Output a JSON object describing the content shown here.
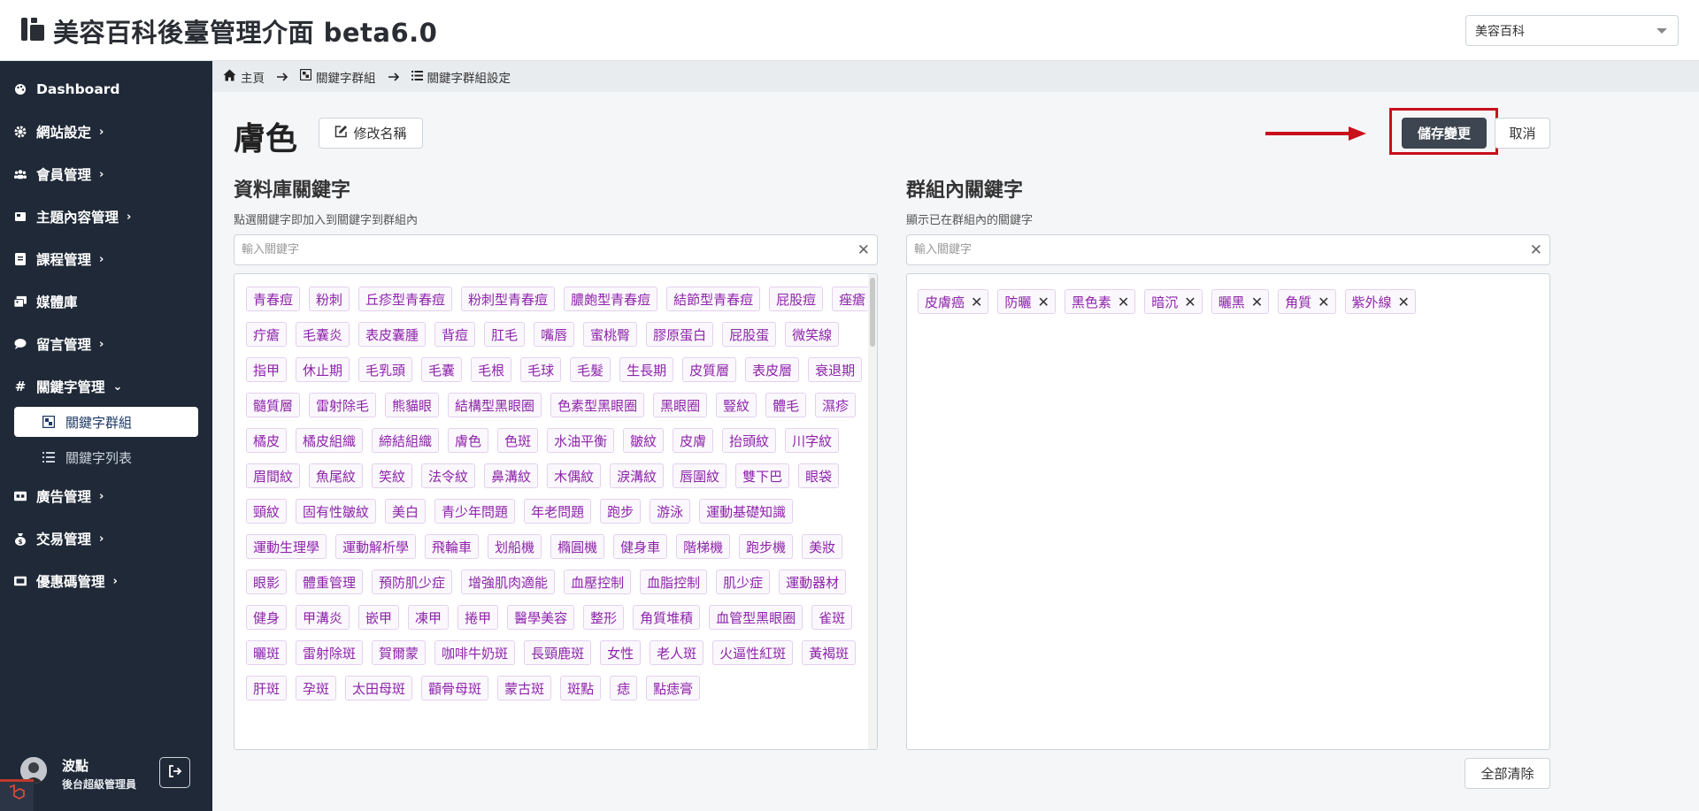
{
  "app": {
    "title": "美容百科後臺管理介面 beta6.0"
  },
  "site_select": {
    "value": "美容百科"
  },
  "sidebar": {
    "items": [
      {
        "label": "Dashboard",
        "icon": "palette-icon"
      },
      {
        "label": "網站設定",
        "icon": "gear-icon"
      },
      {
        "label": "會員管理",
        "icon": "users-icon"
      },
      {
        "label": "主題內容管理",
        "icon": "book-icon"
      },
      {
        "label": "課程管理",
        "icon": "notebook-icon"
      },
      {
        "label": "媒體庫",
        "icon": "images-icon"
      },
      {
        "label": "留言管理",
        "icon": "comment-icon"
      },
      {
        "label": "關鍵字管理",
        "icon": "hashtag-icon"
      },
      {
        "label": "廣告管理",
        "icon": "ad-icon"
      },
      {
        "label": "交易管理",
        "icon": "money-bag-icon"
      },
      {
        "label": "優惠碼管理",
        "icon": "ticket-icon"
      }
    ],
    "sub_items": [
      {
        "label": "關鍵字群組",
        "icon": "group-icon"
      },
      {
        "label": "關鍵字列表",
        "icon": "list-icon"
      }
    ]
  },
  "user": {
    "name": "波點",
    "role": "後台超級管理員"
  },
  "breadcrumb": {
    "home": "主頁",
    "level1": "關鍵字群組",
    "level2": "關鍵字群組設定"
  },
  "page": {
    "title": "膚色",
    "rename_label": "修改名稱",
    "save_label": "儲存變更",
    "cancel_label": "取消",
    "clear_all_label": "全部清除"
  },
  "database": {
    "title": "資料庫關鍵字",
    "subtitle": "點選關鍵字即加入到關鍵字到群組內",
    "search_placeholder": "輸入關鍵字",
    "keywords": [
      "青春痘",
      "粉刺",
      "丘疹型青春痘",
      "粉刺型青春痘",
      "膿皰型青春痘",
      "結節型青春痘",
      "屁股痘",
      "痤瘡",
      "疔瘡",
      "毛囊炎",
      "表皮囊腫",
      "背痘",
      "肛毛",
      "嘴唇",
      "蜜桃臀",
      "膠原蛋白",
      "屁股蛋",
      "微笑線",
      "指甲",
      "休止期",
      "毛乳頭",
      "毛囊",
      "毛根",
      "毛球",
      "毛髮",
      "生長期",
      "皮質層",
      "表皮層",
      "衰退期",
      "髓質層",
      "雷射除毛",
      "熊貓眼",
      "結構型黑眼圈",
      "色素型黑眼圈",
      "黑眼圈",
      "豎紋",
      "體毛",
      "濕疹",
      "橘皮",
      "橘皮組織",
      "締結組織",
      "膚色",
      "色斑",
      "水油平衡",
      "皺紋",
      "皮膚",
      "抬頭紋",
      "川字紋",
      "眉間紋",
      "魚尾紋",
      "笑紋",
      "法令紋",
      "鼻溝紋",
      "木偶紋",
      "淚溝紋",
      "唇圍紋",
      "雙下巴",
      "眼袋",
      "頸紋",
      "固有性皺紋",
      "美白",
      "青少年問題",
      "年老問題",
      "跑步",
      "游泳",
      "運動基礎知識",
      "運動生理學",
      "運動解析學",
      "飛輪車",
      "划船機",
      "橢圓機",
      "健身車",
      "階梯機",
      "跑步機",
      "美妝",
      "眼影",
      "體重管理",
      "預防肌少症",
      "增強肌肉適能",
      "血壓控制",
      "血脂控制",
      "肌少症",
      "運動器材",
      "健身",
      "甲溝炎",
      "嵌甲",
      "凍甲",
      "捲甲",
      "醫學美容",
      "整形",
      "角質堆積",
      "血管型黑眼圈",
      "雀斑",
      "曬斑",
      "雷射除斑",
      "賀爾蒙",
      "咖啡牛奶斑",
      "長頸鹿斑",
      "女性",
      "老人斑",
      "火逼性紅斑",
      "黃褐斑",
      "肝斑",
      "孕斑",
      "太田母斑",
      "顴骨母斑",
      "蒙古斑",
      "斑點",
      "痣",
      "點痣膏"
    ]
  },
  "group": {
    "title": "群組內關鍵字",
    "subtitle": "顯示已在群組內的關鍵字",
    "search_placeholder": "輸入關鍵字",
    "keywords": [
      "皮膚癌",
      "防曬",
      "黑色素",
      "暗沉",
      "曬黑",
      "角質",
      "紫外線"
    ]
  },
  "colors": {
    "sidebar_bg": "#1f2937",
    "tag_text": "#8e24aa",
    "save_bg": "#3c4550",
    "highlight": "#c8101b"
  }
}
